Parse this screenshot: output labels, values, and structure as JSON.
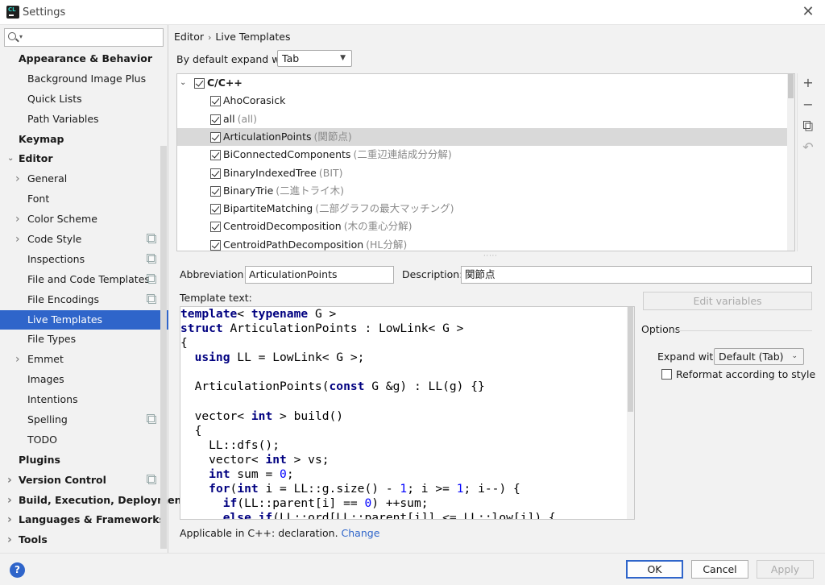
{
  "window": {
    "title": "Settings",
    "app_icon_text": "CL"
  },
  "search": {
    "value": "",
    "placeholder": ""
  },
  "sidebar": {
    "items": [
      {
        "label": "Appearance & Behavior",
        "level": 0,
        "bold": true,
        "arrow": false
      },
      {
        "label": "Background Image Plus",
        "level": 1
      },
      {
        "label": "Quick Lists",
        "level": 1
      },
      {
        "label": "Path Variables",
        "level": 1
      },
      {
        "label": "Keymap",
        "level": 0,
        "bold": true
      },
      {
        "label": "Editor",
        "level": 0,
        "bold": true,
        "arrow": "down"
      },
      {
        "label": "General",
        "level": 1,
        "arrow": "right"
      },
      {
        "label": "Font",
        "level": 1
      },
      {
        "label": "Color Scheme",
        "level": 1,
        "arrow": "right"
      },
      {
        "label": "Code Style",
        "level": 1,
        "arrow": "right",
        "copy": true
      },
      {
        "label": "Inspections",
        "level": 1,
        "copy": true
      },
      {
        "label": "File and Code Templates",
        "level": 1,
        "copy": true
      },
      {
        "label": "File Encodings",
        "level": 1,
        "copy": true
      },
      {
        "label": "Live Templates",
        "level": 1,
        "selected": true
      },
      {
        "label": "File Types",
        "level": 1
      },
      {
        "label": "Emmet",
        "level": 1,
        "arrow": "right"
      },
      {
        "label": "Images",
        "level": 1
      },
      {
        "label": "Intentions",
        "level": 1
      },
      {
        "label": "Spelling",
        "level": 1,
        "copy": true
      },
      {
        "label": "TODO",
        "level": 1
      },
      {
        "label": "Plugins",
        "level": 0,
        "bold": true
      },
      {
        "label": "Version Control",
        "level": 0,
        "bold": true,
        "arrow": "right",
        "copy": true
      },
      {
        "label": "Build, Execution, Deployment",
        "level": 0,
        "bold": true,
        "arrow": "right"
      },
      {
        "label": "Languages & Frameworks",
        "level": 0,
        "bold": true,
        "arrow": "right"
      },
      {
        "label": "Tools",
        "level": 0,
        "bold": true,
        "arrow": "right"
      }
    ]
  },
  "breadcrumb": {
    "parent": "Editor",
    "separator": "›",
    "current": "Live Templates"
  },
  "expand": {
    "label": "By default expand with",
    "value": "Tab"
  },
  "template_group": {
    "name": "C/C++",
    "checked": true
  },
  "templates": [
    {
      "name": "AhoCorasick",
      "desc": "",
      "checked": true
    },
    {
      "name": "all",
      "desc": "(all)",
      "checked": true
    },
    {
      "name": "ArticulationPoints",
      "desc": "(関節点)",
      "checked": true,
      "selected": true
    },
    {
      "name": "BiConnectedComponents",
      "desc": "(二重辺連結成分分解)",
      "checked": true
    },
    {
      "name": "BinaryIndexedTree",
      "desc": "(BIT)",
      "checked": true
    },
    {
      "name": "BinaryTrie",
      "desc": "(二進トライ木)",
      "checked": true
    },
    {
      "name": "BipartiteMatching",
      "desc": "(二部グラフの最大マッチング)",
      "checked": true
    },
    {
      "name": "CentroidDecomposition",
      "desc": "(木の重心分解)",
      "checked": true
    },
    {
      "name": "CentroidPathDecomposition",
      "desc": "(HL分解)",
      "checked": true
    }
  ],
  "tools": {
    "add": "+",
    "remove": "−",
    "copy": "copy-icon",
    "revert": "↶"
  },
  "abbreviation": {
    "label": "Abbreviation:",
    "value": "ArticulationPoints"
  },
  "description": {
    "label": "Description:",
    "value": "関節点"
  },
  "template_text": {
    "label": "Template text:"
  },
  "code_lines": [
    [
      [
        "kw",
        "template"
      ],
      [
        "t",
        "< "
      ],
      [
        "kw",
        "typename"
      ],
      [
        "t",
        " G >"
      ]
    ],
    [
      [
        "kw",
        "struct"
      ],
      [
        "t",
        " ArticulationPoints : LowLink< G >"
      ]
    ],
    [
      [
        "t",
        "{"
      ]
    ],
    [
      [
        "t",
        "  "
      ],
      [
        "kw",
        "using"
      ],
      [
        "t",
        " LL = LowLink< G >;"
      ]
    ],
    [
      [
        "t",
        ""
      ]
    ],
    [
      [
        "t",
        "  ArticulationPoints("
      ],
      [
        "kw",
        "const"
      ],
      [
        "t",
        " G &g) : LL(g) {}"
      ]
    ],
    [
      [
        "t",
        ""
      ]
    ],
    [
      [
        "t",
        "  vector< "
      ],
      [
        "kw",
        "int"
      ],
      [
        "t",
        " > build()"
      ]
    ],
    [
      [
        "t",
        "  {"
      ]
    ],
    [
      [
        "t",
        "    LL::dfs();"
      ]
    ],
    [
      [
        "t",
        "    vector< "
      ],
      [
        "kw",
        "int"
      ],
      [
        "t",
        " > vs;"
      ]
    ],
    [
      [
        "t",
        "    "
      ],
      [
        "kw",
        "int"
      ],
      [
        "t",
        " sum = "
      ],
      [
        "num",
        "0"
      ],
      [
        "t",
        ";"
      ]
    ],
    [
      [
        "t",
        "    "
      ],
      [
        "kw",
        "for"
      ],
      [
        "t",
        "("
      ],
      [
        "kw",
        "int"
      ],
      [
        "t",
        " i = LL::g.size() - "
      ],
      [
        "num",
        "1"
      ],
      [
        "t",
        "; i >= "
      ],
      [
        "num",
        "1"
      ],
      [
        "t",
        "; i--) {"
      ]
    ],
    [
      [
        "t",
        "      "
      ],
      [
        "kw",
        "if"
      ],
      [
        "t",
        "(LL::parent[i] == "
      ],
      [
        "num",
        "0"
      ],
      [
        "t",
        ") ++sum;"
      ]
    ],
    [
      [
        "t",
        "      "
      ],
      [
        "kw",
        "else if"
      ],
      [
        "t",
        "(LL::ord[LL::parent[i]] <= LL::low[i]) {"
      ]
    ]
  ],
  "edit_variables": {
    "label": "Edit variables"
  },
  "options": {
    "title": "Options",
    "expand_label": "Expand with",
    "expand_value": "Default (Tab)",
    "reformat_label": "Reformat according to style",
    "reformat_checked": false
  },
  "applicable": {
    "text": "Applicable in C++: declaration.",
    "link": "Change"
  },
  "footer": {
    "help": "?",
    "ok": "OK",
    "cancel": "Cancel",
    "apply": "Apply"
  }
}
